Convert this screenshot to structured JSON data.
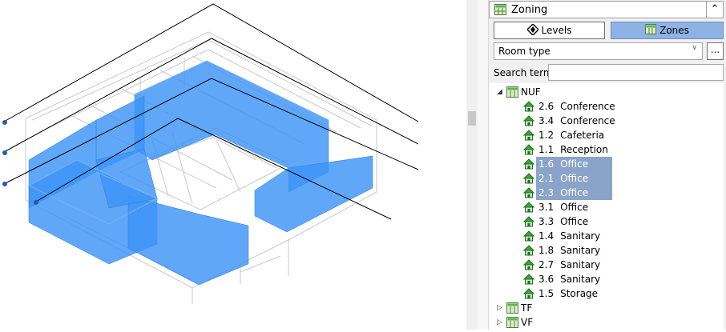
{
  "panel": {
    "title": "Zoning",
    "collapse_icon": "chevron-up-icon",
    "buttons": {
      "levels": "Levels",
      "zones": "Zones",
      "active": "zones"
    },
    "combo": {
      "value": "Room type"
    },
    "more_button": "...",
    "search": {
      "label": "Search term",
      "value": ""
    }
  },
  "tree": {
    "groups": [
      {
        "label": "NUF",
        "expanded": true,
        "items": [
          {
            "num": "2.6",
            "name": "Conference",
            "selected": false
          },
          {
            "num": "3.4",
            "name": "Conference",
            "selected": false
          },
          {
            "num": "1.2",
            "name": "Cafeteria",
            "selected": false
          },
          {
            "num": "1.1",
            "name": "Reception",
            "selected": false
          },
          {
            "num": "1.6",
            "name": "Office",
            "selected": true
          },
          {
            "num": "2.1",
            "name": "Office",
            "selected": true
          },
          {
            "num": "2.3",
            "name": "Office",
            "selected": true
          },
          {
            "num": "3.1",
            "name": "Office",
            "selected": false
          },
          {
            "num": "3.3",
            "name": "Office",
            "selected": false
          },
          {
            "num": "1.4",
            "name": "Sanitary",
            "selected": false
          },
          {
            "num": "1.8",
            "name": "Sanitary",
            "selected": false
          },
          {
            "num": "2.7",
            "name": "Sanitary",
            "selected": false
          },
          {
            "num": "3.6",
            "name": "Sanitary",
            "selected": false
          },
          {
            "num": "1.5",
            "name": "Storage",
            "selected": false
          }
        ]
      },
      {
        "label": "TF",
        "expanded": false,
        "items": []
      },
      {
        "label": "VF",
        "expanded": false,
        "items": []
      }
    ]
  },
  "colors": {
    "zone_fill": "#3d94f6",
    "selection": "#8aa3c8",
    "active_toggle": "#8fb2e6"
  }
}
